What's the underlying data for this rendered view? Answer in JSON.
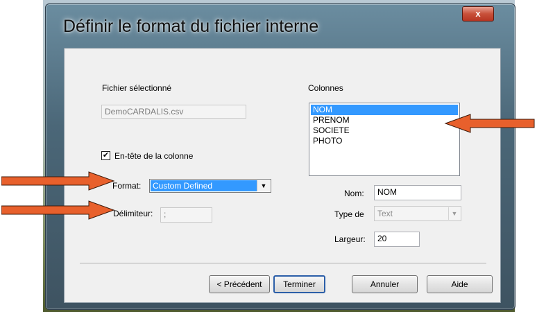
{
  "dialog": {
    "title": "Définir le format du fichier interne",
    "close_label": "x"
  },
  "left": {
    "file_label": "Fichier sélectionné",
    "file_value": "DemoCARDALIS.csv",
    "header_checkbox_label": "En-tête de la colonne",
    "header_checkbox_checked": true,
    "format_label": "Format:",
    "format_value": "Custom Defined",
    "delimiter_label": "Délimiteur:",
    "delimiter_value": ";"
  },
  "columns": {
    "label": "Colonnes",
    "items": [
      "NOM",
      "PRENOM",
      "SOCIETE",
      "PHOTO"
    ],
    "selected_index": 0
  },
  "details": {
    "name_label": "Nom:",
    "name_value": "NOM",
    "type_label": "Type de",
    "type_value": "Text",
    "width_label": "Largeur:",
    "width_value": "20"
  },
  "buttons": {
    "previous": "< Précédent",
    "finish": "Terminer",
    "cancel": "Annuler",
    "help": "Aide"
  },
  "colors": {
    "selection": "#3399ff",
    "arrow": "#e8602c"
  }
}
